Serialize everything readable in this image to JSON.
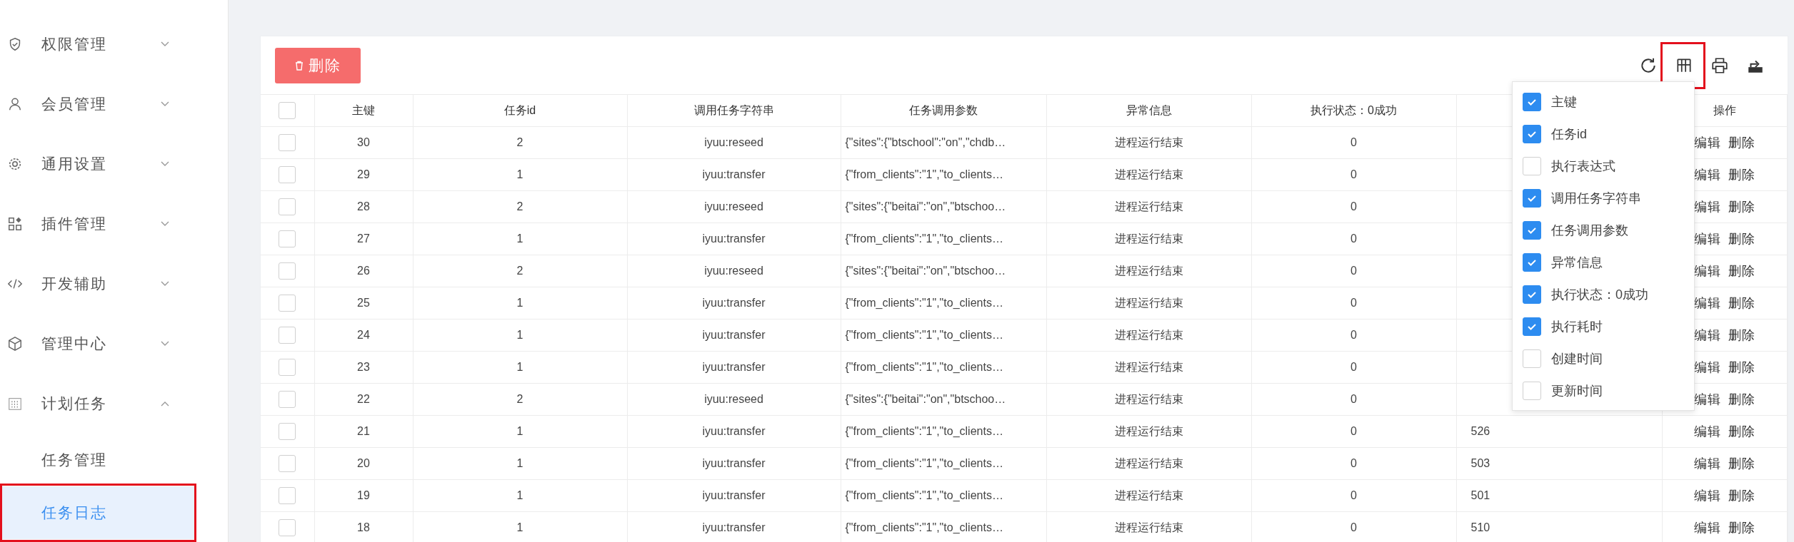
{
  "sidebar": {
    "items": [
      {
        "label": "权限管理",
        "expanded": false
      },
      {
        "label": "会员管理",
        "expanded": false
      },
      {
        "label": "通用设置",
        "expanded": false
      },
      {
        "label": "插件管理",
        "expanded": false
      },
      {
        "label": "开发辅助",
        "expanded": false
      },
      {
        "label": "管理中心",
        "expanded": false
      },
      {
        "label": "计划任务",
        "expanded": true,
        "children": [
          {
            "label": "任务管理",
            "selected": false
          },
          {
            "label": "任务日志",
            "selected": true
          }
        ]
      }
    ]
  },
  "toolbar": {
    "delete_button": "删除"
  },
  "column_menu": [
    {
      "label": "主键",
      "checked": true
    },
    {
      "label": "任务id",
      "checked": true
    },
    {
      "label": "执行表达式",
      "checked": false
    },
    {
      "label": "调用任务字符串",
      "checked": true
    },
    {
      "label": "任务调用参数",
      "checked": true
    },
    {
      "label": "异常信息",
      "checked": true
    },
    {
      "label": "执行状态：0成功",
      "checked": true
    },
    {
      "label": "执行耗时",
      "checked": true
    },
    {
      "label": "创建时间",
      "checked": false
    },
    {
      "label": "更新时间",
      "checked": false
    }
  ],
  "table": {
    "select_all": {
      "checked": false
    },
    "columns": [
      "主键",
      "任务id",
      "调用任务字符串",
      "任务调用参数",
      "异常信息",
      "执行状态：0成功",
      "操作"
    ],
    "rows": [
      {
        "checked": false,
        "id": "30",
        "task_id": "2",
        "invoke": "iyuu:reseed",
        "params": "{\"sites\":{\"btschool\":\"on\",\"chdb…",
        "error": "进程运行结束",
        "status": "0",
        "actions": [
          "编辑",
          "删除"
        ]
      },
      {
        "checked": false,
        "id": "29",
        "task_id": "1",
        "invoke": "iyuu:transfer",
        "params": "{\"from_clients\":\"1\",\"to_clients…",
        "error": "进程运行结束",
        "status": "0",
        "actions": [
          "编辑",
          "删除"
        ]
      },
      {
        "checked": false,
        "id": "28",
        "task_id": "2",
        "invoke": "iyuu:reseed",
        "params": "{\"sites\":{\"beitai\":\"on\",\"btschoo…",
        "error": "进程运行结束",
        "status": "0",
        "actions": [
          "编辑",
          "删除"
        ]
      },
      {
        "checked": false,
        "id": "27",
        "task_id": "1",
        "invoke": "iyuu:transfer",
        "params": "{\"from_clients\":\"1\",\"to_clients…",
        "error": "进程运行结束",
        "status": "0",
        "actions": [
          "编辑",
          "删除"
        ]
      },
      {
        "checked": false,
        "id": "26",
        "task_id": "2",
        "invoke": "iyuu:reseed",
        "params": "{\"sites\":{\"beitai\":\"on\",\"btschoo…",
        "error": "进程运行结束",
        "status": "0",
        "actions": [
          "编辑",
          "删除"
        ]
      },
      {
        "checked": false,
        "id": "25",
        "task_id": "1",
        "invoke": "iyuu:transfer",
        "params": "{\"from_clients\":\"1\",\"to_clients…",
        "error": "进程运行结束",
        "status": "0",
        "actions": [
          "编辑",
          "删除"
        ]
      },
      {
        "checked": false,
        "id": "24",
        "task_id": "1",
        "invoke": "iyuu:transfer",
        "params": "{\"from_clients\":\"1\",\"to_clients…",
        "error": "进程运行结束",
        "status": "0",
        "actions": [
          "编辑",
          "删除"
        ]
      },
      {
        "checked": false,
        "id": "23",
        "task_id": "1",
        "invoke": "iyuu:transfer",
        "params": "{\"from_clients\":\"1\",\"to_clients…",
        "error": "进程运行结束",
        "status": "0",
        "actions": [
          "编辑",
          "删除"
        ]
      },
      {
        "checked": false,
        "id": "22",
        "task_id": "2",
        "invoke": "iyuu:reseed",
        "params": "{\"sites\":{\"beitai\":\"on\",\"btschoo…",
        "error": "进程运行结束",
        "status": "0",
        "actions": [
          "编辑",
          "删除"
        ]
      },
      {
        "checked": false,
        "id": "21",
        "task_id": "1",
        "invoke": "iyuu:transfer",
        "params": "{\"from_clients\":\"1\",\"to_clients…",
        "error": "进程运行结束",
        "status": "0",
        "duration": "526",
        "actions": [
          "编辑",
          "删除"
        ]
      },
      {
        "checked": false,
        "id": "20",
        "task_id": "1",
        "invoke": "iyuu:transfer",
        "params": "{\"from_clients\":\"1\",\"to_clients…",
        "error": "进程运行结束",
        "status": "0",
        "duration": "503",
        "actions": [
          "编辑",
          "删除"
        ]
      },
      {
        "checked": false,
        "id": "19",
        "task_id": "1",
        "invoke": "iyuu:transfer",
        "params": "{\"from_clients\":\"1\",\"to_clients…",
        "error": "进程运行结束",
        "status": "0",
        "duration": "501",
        "actions": [
          "编辑",
          "删除"
        ]
      },
      {
        "checked": false,
        "id": "18",
        "task_id": "1",
        "invoke": "iyuu:transfer",
        "params": "{\"from_clients\":\"1\",\"to_clients…",
        "error": "进程运行结束",
        "status": "0",
        "duration": "510",
        "actions": [
          "编辑",
          "删除"
        ]
      }
    ]
  }
}
